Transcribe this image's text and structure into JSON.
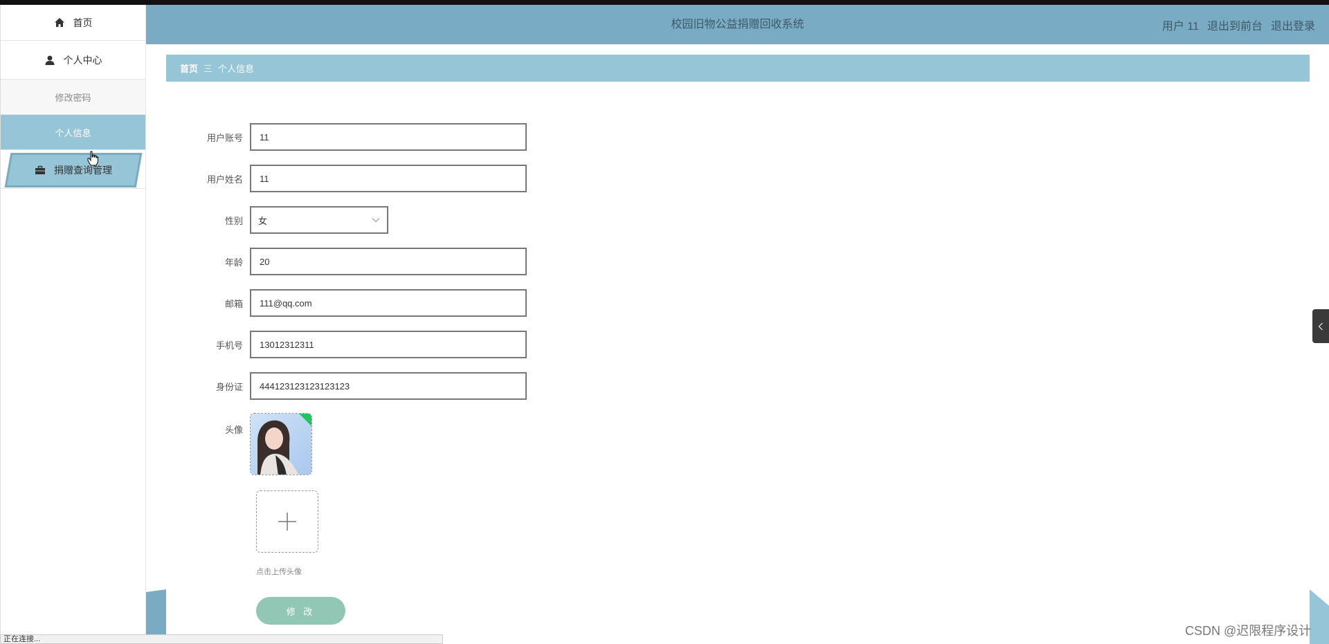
{
  "app": {
    "title": "校园旧物公益捐赠回收系统"
  },
  "header": {
    "user_label": "用户 11",
    "front_link": "退出到前台",
    "logout_link": "退出登录"
  },
  "sidebar": {
    "home": "首页",
    "personal_center": "个人中心",
    "change_password": "修改密码",
    "personal_info": "个人信息",
    "donation_mgmt": "捐赠查询管理"
  },
  "breadcrumb": {
    "home": "首页",
    "separator": "三",
    "current": "个人信息"
  },
  "form": {
    "account_label": "用户账号",
    "account_value": "11",
    "name_label": "用户姓名",
    "name_value": "11",
    "gender_label": "性别",
    "gender_value": "女",
    "age_label": "年龄",
    "age_value": "20",
    "email_label": "邮箱",
    "email_value": "111@qq.com",
    "phone_label": "手机号",
    "phone_value": "13012312311",
    "idcard_label": "身份证",
    "idcard_value": "444123123123123123",
    "avatar_label": "头像",
    "upload_hint": "点击上传头像",
    "submit_label": "修 改"
  },
  "status_bar": {
    "text": "正在连接..."
  },
  "watermark": "CSDN @迟限程序设计",
  "colors": {
    "header_bg": "#7aabc4",
    "accent": "#96c5d7",
    "submit": "#93c7b5"
  }
}
